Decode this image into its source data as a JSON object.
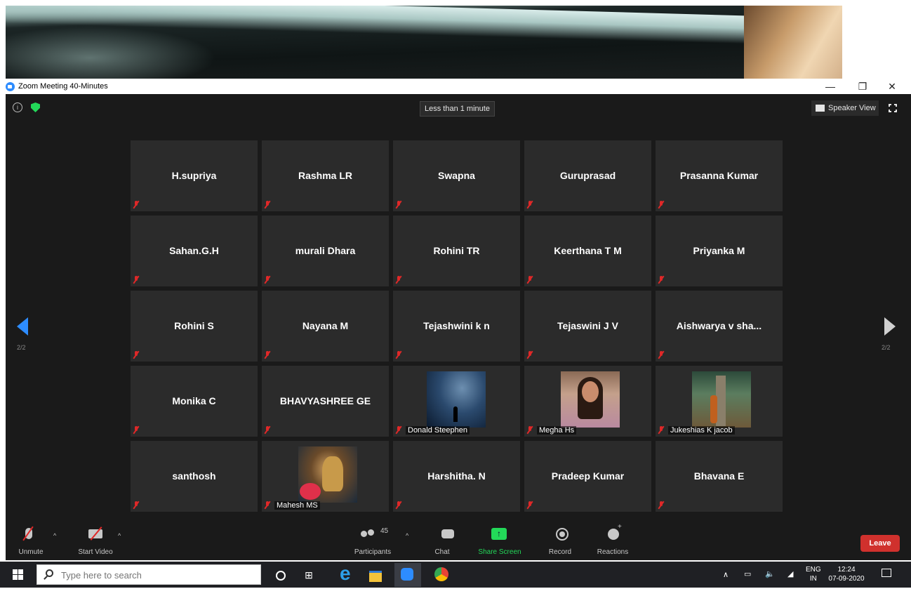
{
  "window": {
    "title": "Zoom Meeting 40-Minutes",
    "controls": {
      "minimize": "—",
      "restore": "❐",
      "close": "✕"
    }
  },
  "meeting": {
    "timer": "Less than 1 minute",
    "view_button": "Speaker View",
    "page_left": "2/2",
    "page_right": "2/2",
    "tiles": [
      {
        "name": "H.supriya",
        "muted": true
      },
      {
        "name": "Rashma LR",
        "muted": true
      },
      {
        "name": "Swapna",
        "muted": true
      },
      {
        "name": "Guruprasad",
        "muted": true
      },
      {
        "name": "Prasanna Kumar",
        "muted": true
      },
      {
        "name": "Sahan.G.H",
        "muted": true
      },
      {
        "name": "murali Dhara",
        "muted": true
      },
      {
        "name": "Rohini TR",
        "muted": true
      },
      {
        "name": "Keerthana T M",
        "muted": true
      },
      {
        "name": "Priyanka M",
        "muted": true
      },
      {
        "name": "Rohini S",
        "muted": true
      },
      {
        "name": "Nayana M",
        "muted": true
      },
      {
        "name": "Tejashwini k n",
        "muted": true
      },
      {
        "name": "Tejaswini J V",
        "muted": true
      },
      {
        "name": "Aishwarya v sha...",
        "muted": true
      },
      {
        "name": "Monika C",
        "muted": true
      },
      {
        "name": "BHAVYASHREE GE",
        "muted": true
      },
      {
        "name": "Donald Steephen",
        "muted": true,
        "photo": "space"
      },
      {
        "name": "Megha Hs",
        "muted": true,
        "photo": "megha"
      },
      {
        "name": "Jukeshias K jacob",
        "muted": true,
        "photo": "forest"
      },
      {
        "name": "santhosh",
        "muted": true
      },
      {
        "name": "Mahesh MS",
        "muted": true,
        "photo": "ganesh"
      },
      {
        "name": "Harshitha. N",
        "muted": true
      },
      {
        "name": "Pradeep Kumar",
        "muted": true
      },
      {
        "name": "Bhavana E",
        "muted": true
      }
    ]
  },
  "toolbar": {
    "unmute": "Unmute",
    "start_video": "Start Video",
    "participants": "Participants",
    "participants_count": "45",
    "chat": "Chat",
    "share_screen": "Share Screen",
    "record": "Record",
    "reactions": "Reactions",
    "leave": "Leave"
  },
  "taskbar": {
    "search_placeholder": "Type here to search",
    "lang_top": "ENG",
    "lang_bottom": "IN",
    "time": "12:24",
    "date": "07-09-2020"
  },
  "colors": {
    "meeting_bg": "#1a1a1a",
    "tile_bg": "#2b2b2b",
    "accent_blue": "#2d8cff",
    "share_green": "#23d959",
    "leave_red": "#d0312d",
    "muted_red": "#e02828"
  }
}
